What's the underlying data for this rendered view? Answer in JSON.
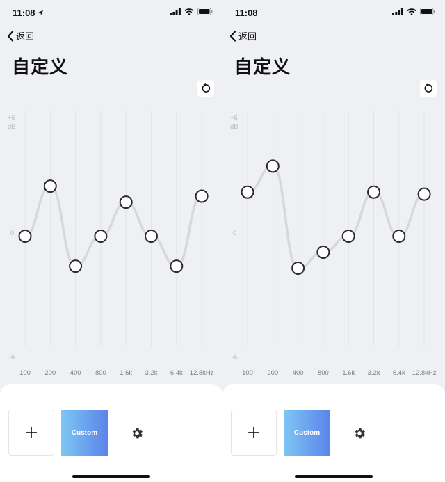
{
  "screens": [
    {
      "status": {
        "time": "11:08",
        "show_location_arrow": true
      },
      "nav": {
        "back_label": "返回"
      },
      "title": "自定义",
      "eq": {
        "db_max_label": "+6",
        "db_unit_label": "dB",
        "db_zero_label": "0",
        "db_min_label": "-6",
        "bands": [
          "100",
          "200",
          "400",
          "800",
          "1.6k",
          "3.2k",
          "6.4k",
          "12.8kHz"
        ]
      },
      "presets": {
        "custom_label": "Custom"
      }
    },
    {
      "status": {
        "time": "11:08",
        "show_location_arrow": false
      },
      "nav": {
        "back_label": "返回"
      },
      "title": "自定义",
      "eq": {
        "db_max_label": "+6",
        "db_unit_label": "dB",
        "db_zero_label": "0",
        "db_min_label": "-6",
        "bands": [
          "100",
          "200",
          "400",
          "800",
          "1.6k",
          "3.2k",
          "6.4k",
          "12.8kHz"
        ]
      },
      "presets": {
        "custom_label": "Custom"
      }
    }
  ],
  "chart_data": [
    {
      "type": "line",
      "x": [
        "100",
        "200",
        "400",
        "800",
        "1.6k",
        "3.2k",
        "6.4k",
        "12.8kHz"
      ],
      "series": [
        {
          "values": [
            0,
            2.5,
            -1.5,
            0,
            1.7,
            0,
            -1.5,
            2.0
          ]
        }
      ],
      "ylim": [
        -6,
        6
      ],
      "ylabel": "dB"
    },
    {
      "type": "line",
      "x": [
        "100",
        "200",
        "400",
        "800",
        "1.6k",
        "3.2k",
        "6.4k",
        "12.8kHz"
      ],
      "series": [
        {
          "values": [
            2.2,
            3.5,
            -1.6,
            -0.8,
            0,
            2.2,
            0,
            2.1
          ]
        }
      ],
      "ylim": [
        -6,
        6
      ],
      "ylabel": "dB"
    }
  ],
  "colors": {
    "background": "#eef0f3",
    "curve": "#d6d8db",
    "node_stroke": "#2b2b2b",
    "preset_gradient_start": "#7ec6f4",
    "preset_gradient_end": "#5b84ea"
  },
  "icons": {
    "back": "chevron-left-icon",
    "reset": "reset-icon",
    "add": "plus-icon",
    "settings": "gear-icon",
    "signal": "signal-icon",
    "wifi": "wifi-icon",
    "battery": "battery-icon",
    "location": "location-arrow-icon"
  }
}
